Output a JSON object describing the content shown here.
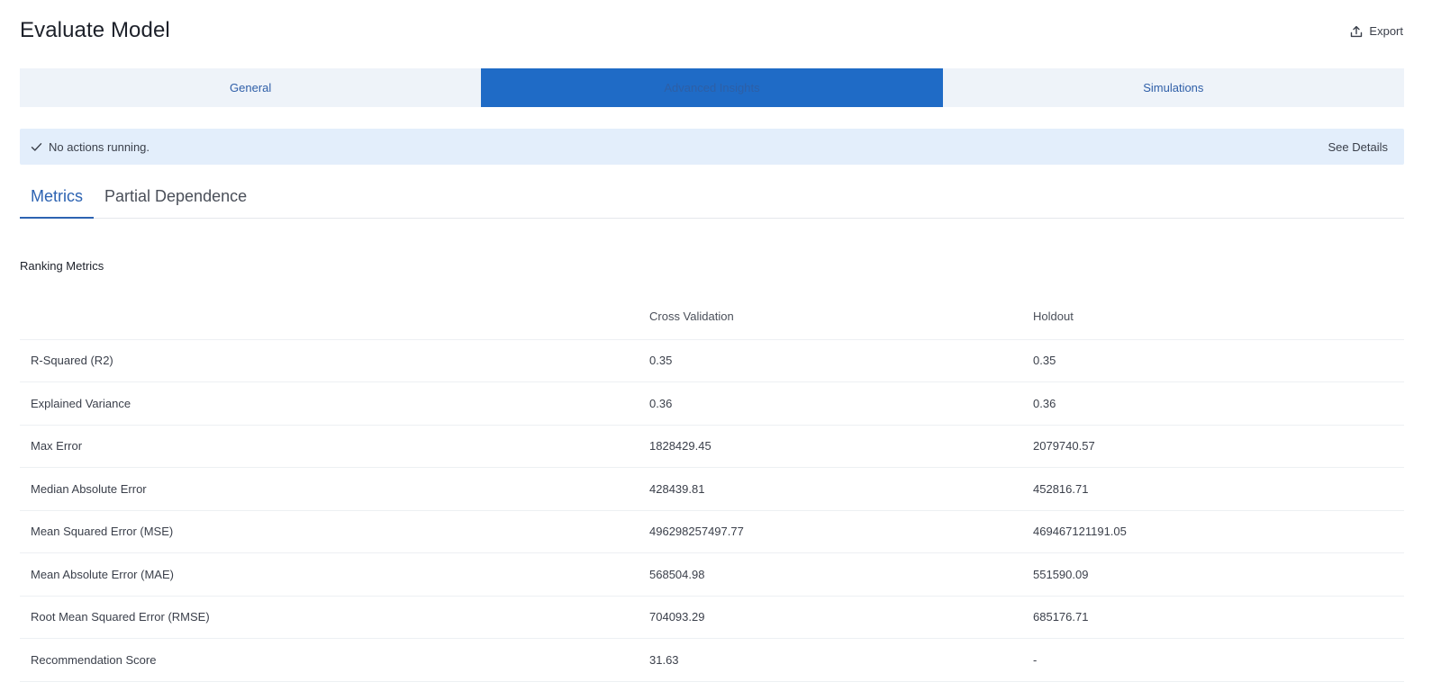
{
  "header": {
    "title": "Evaluate Model",
    "export_label": "Export"
  },
  "top_tabs": [
    {
      "label": "General",
      "active": false
    },
    {
      "label": "Advanced Insights",
      "active": true
    },
    {
      "label": "Simulations",
      "active": false
    }
  ],
  "status": {
    "text": "No actions running.",
    "details_label": "See Details"
  },
  "sub_tabs": [
    {
      "label": "Metrics",
      "active": true
    },
    {
      "label": "Partial Dependence",
      "active": false
    }
  ],
  "section": {
    "title": "Ranking Metrics"
  },
  "table": {
    "headers": [
      "",
      "Cross Validation",
      "Holdout"
    ],
    "rows": [
      {
        "name": "R-Squared (R2)",
        "cv": "0.35",
        "holdout": "0.35"
      },
      {
        "name": "Explained Variance",
        "cv": "0.36",
        "holdout": "0.36"
      },
      {
        "name": "Max Error",
        "cv": "1828429.45",
        "holdout": "2079740.57"
      },
      {
        "name": "Median Absolute Error",
        "cv": "428439.81",
        "holdout": "452816.71"
      },
      {
        "name": "Mean Squared Error (MSE)",
        "cv": "496298257497.77",
        "holdout": "469467121191.05"
      },
      {
        "name": "Mean Absolute Error (MAE)",
        "cv": "568504.98",
        "holdout": "551590.09"
      },
      {
        "name": "Root Mean Squared Error (RMSE)",
        "cv": "704093.29",
        "holdout": "685176.71"
      },
      {
        "name": "Recommendation Score",
        "cv": "31.63",
        "holdout": "-"
      }
    ]
  },
  "colors": {
    "accent": "#1f6bc6",
    "tab_bg": "#eef3f9",
    "status_bg": "#e3eefb",
    "link": "#2d63b2"
  },
  "icons": {
    "export": "upload-icon",
    "status": "check-icon"
  }
}
